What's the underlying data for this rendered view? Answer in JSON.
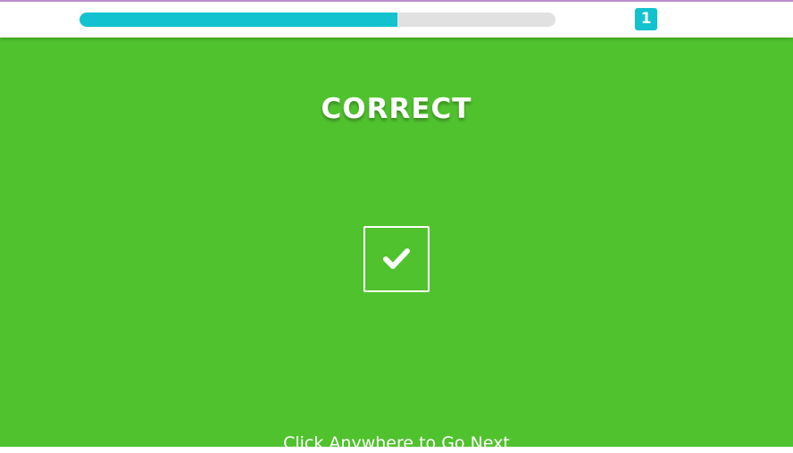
{
  "colors": {
    "background": "#50c22e",
    "progress_fill": "#12c2cf",
    "progress_track": "#e1e1e1",
    "badge": "#12c2cf",
    "text": "#ffffff"
  },
  "progress": {
    "fraction": 0.667
  },
  "score": {
    "value": "1"
  },
  "result": {
    "title": "CORRECT",
    "icon": "check-icon"
  },
  "footer": {
    "hint": "Click Anywhere to Go Next"
  }
}
